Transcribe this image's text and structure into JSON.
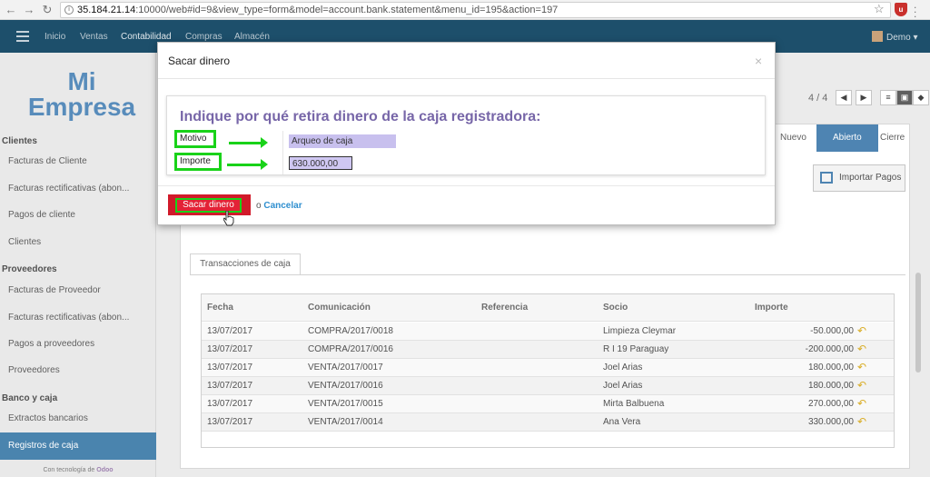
{
  "browser": {
    "url_host": "35.184.21.14",
    "url_rest": ":10000/web#id=9&view_type=form&model=account.bank.statement&menu_id=195&action=197"
  },
  "topnav": {
    "menu": [
      "Inicio",
      "Ventas",
      "Contabilidad",
      "Compras",
      "Almacén"
    ],
    "active": "Contabilidad",
    "user": "Demo"
  },
  "sidebar": {
    "logo_line1": "Mi",
    "logo_line2": "Empresa",
    "sections": [
      {
        "title": "Clientes",
        "items": [
          "Facturas de Cliente",
          "Facturas rectificativas (abon...",
          "Pagos de cliente",
          "Clientes"
        ]
      },
      {
        "title": "Proveedores",
        "items": [
          "Facturas de Proveedor",
          "Facturas rectificativas (abon...",
          "Pagos a proveedores",
          "Proveedores"
        ]
      },
      {
        "title": "Banco y caja",
        "items": [
          "Extractos bancarios",
          "Registros de caja"
        ]
      }
    ],
    "active_item": "Registros de caja",
    "powered_prefix": "Con tecnología de",
    "powered_brand": "Odoo"
  },
  "main": {
    "pager": "4 / 4",
    "stages": [
      "Nuevo",
      "Abierto",
      "Cierre"
    ],
    "active_stage": "Abierto",
    "import_button": "Importar Pagos",
    "tab": "Transacciones de caja",
    "table": {
      "headers": [
        "Fecha",
        "Comunicación",
        "Referencia",
        "Socio",
        "Importe"
      ],
      "rows": [
        [
          "13/07/2017",
          "COMPRA/2017/0018",
          "",
          "Limpieza Cleymar",
          "-50.000,00"
        ],
        [
          "13/07/2017",
          "COMPRA/2017/0016",
          "",
          "R I 19 Paraguay",
          "-200.000,00"
        ],
        [
          "13/07/2017",
          "VENTA/2017/0017",
          "",
          "Joel Arias",
          "180.000,00"
        ],
        [
          "13/07/2017",
          "VENTA/2017/0016",
          "",
          "Joel Arias",
          "180.000,00"
        ],
        [
          "13/07/2017",
          "VENTA/2017/0015",
          "",
          "Mirta Balbuena",
          "270.000,00"
        ],
        [
          "13/07/2017",
          "VENTA/2017/0014",
          "",
          "Ana Vera",
          "330.000,00"
        ]
      ]
    }
  },
  "modal": {
    "title": "Sacar dinero",
    "close": "×",
    "prompt": "Indique por qué retira dinero de la caja registradora:",
    "motivo_label": "Motivo",
    "motivo_value": "Arqueo de caja",
    "importe_label": "Importe",
    "importe_value": "630.000,00",
    "primary_button": "Sacar dinero",
    "or_text": "o",
    "cancel": "Cancelar"
  },
  "colors": {
    "nav": "#1d4f6b",
    "highlight": "#19d219",
    "primary": "#e32236",
    "prompt": "#7766a8"
  }
}
